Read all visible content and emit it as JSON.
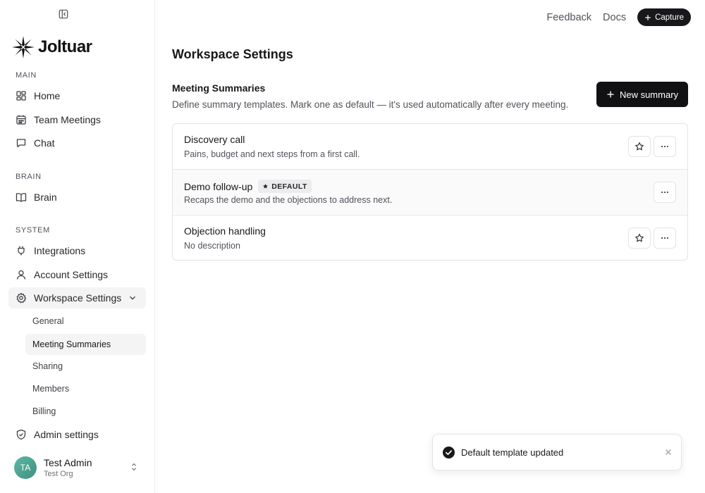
{
  "brand": {
    "name": "Joltuar"
  },
  "topbar": {
    "feedback": "Feedback",
    "docs": "Docs",
    "capture": "Capture"
  },
  "sidebar": {
    "sections": {
      "main": "MAIN",
      "brain": "BRAIN",
      "system": "SYSTEM"
    },
    "items": {
      "home": "Home",
      "team_meetings": "Team Meetings",
      "chat": "Chat",
      "brain": "Brain",
      "integrations": "Integrations",
      "account_settings": "Account Settings",
      "workspace_settings": "Workspace Settings",
      "admin_settings": "Admin settings"
    },
    "workspace_sub": {
      "general": "General",
      "meeting_summaries": "Meeting Summaries",
      "sharing": "Sharing",
      "members": "Members",
      "billing": "Billing"
    },
    "user": {
      "initials": "TA",
      "name": "Test Admin",
      "org": "Test Org"
    }
  },
  "main": {
    "page_title": "Workspace Settings",
    "section_title": "Meeting Summaries",
    "section_desc": "Define summary templates. Mark one as default — it's used automatically after every meeting.",
    "new_button": "New summary",
    "templates": [
      {
        "title": "Discovery call",
        "desc": "Pains, budget and next steps from a first call.",
        "is_default": false
      },
      {
        "title": "Demo follow-up",
        "desc": "Recaps the demo and the objections to address next.",
        "is_default": true,
        "badge": "DEFAULT"
      },
      {
        "title": "Objection handling",
        "desc": "No description",
        "is_default": false
      }
    ]
  },
  "toast": {
    "message": "Default template updated"
  },
  "colors": {
    "primary": "#111113",
    "active_bg": "#f4f4f5",
    "avatar": "#4fa594"
  }
}
